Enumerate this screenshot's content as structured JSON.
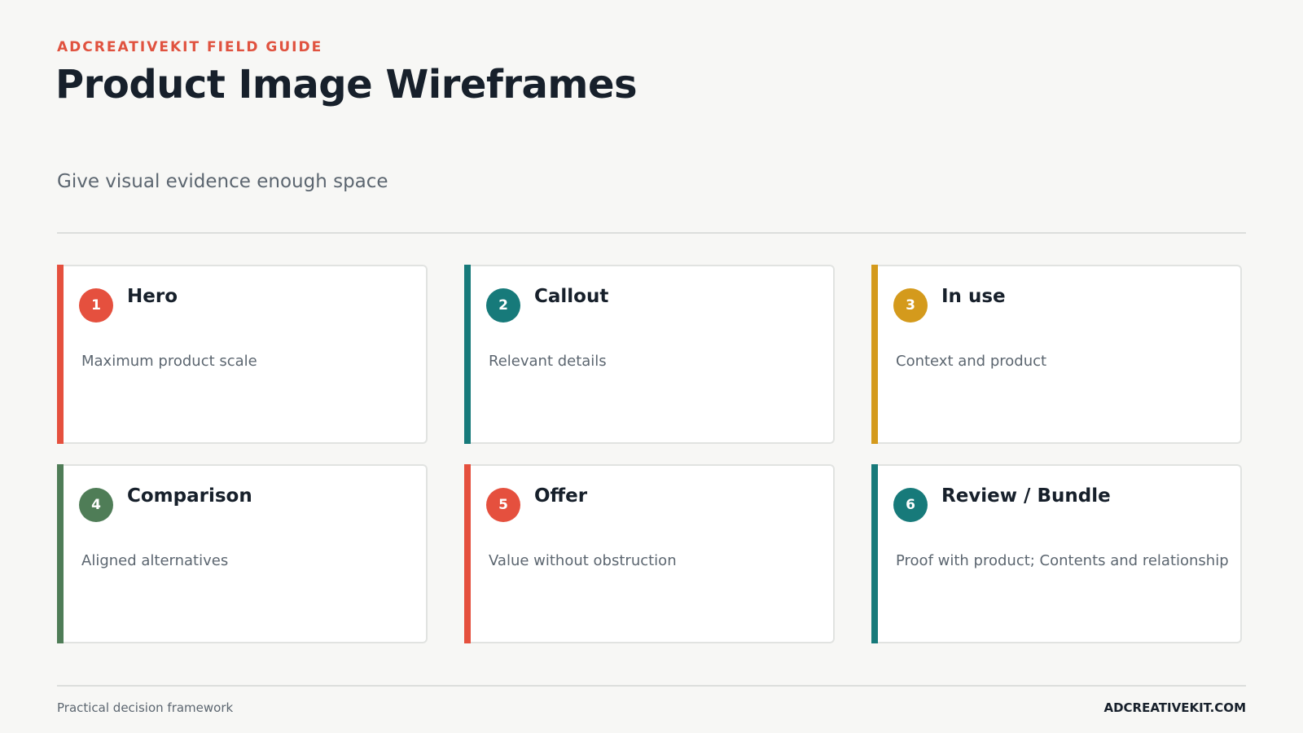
{
  "header": {
    "eyebrow": "ADCREATIVEKIT FIELD GUIDE",
    "title": "Product Image Wireframes",
    "subtitle": "Give visual evidence enough space"
  },
  "cards": [
    {
      "number": "1",
      "title": "Hero",
      "description": "Maximum product scale",
      "color": "#e5503e"
    },
    {
      "number": "2",
      "title": "Callout",
      "description": "Relevant details",
      "color": "#177a7a"
    },
    {
      "number": "3",
      "title": "In use",
      "description": "Context and product",
      "color": "#d49a1c"
    },
    {
      "number": "4",
      "title": "Comparison",
      "description": "Aligned alternatives",
      "color": "#4f7d57"
    },
    {
      "number": "5",
      "title": "Offer",
      "description": "Value without obstruction",
      "color": "#e5503e"
    },
    {
      "number": "6",
      "title": "Review / Bundle",
      "description": "Proof with product; Contents and relationship",
      "color": "#177a7a"
    }
  ],
  "footer": {
    "left": "Practical decision framework",
    "right": "ADCREATIVEKIT.COM"
  },
  "colors": {
    "accent": "#e0523f",
    "background": "#f7f7f5",
    "text": "#17202b",
    "muted": "#5c6670"
  }
}
